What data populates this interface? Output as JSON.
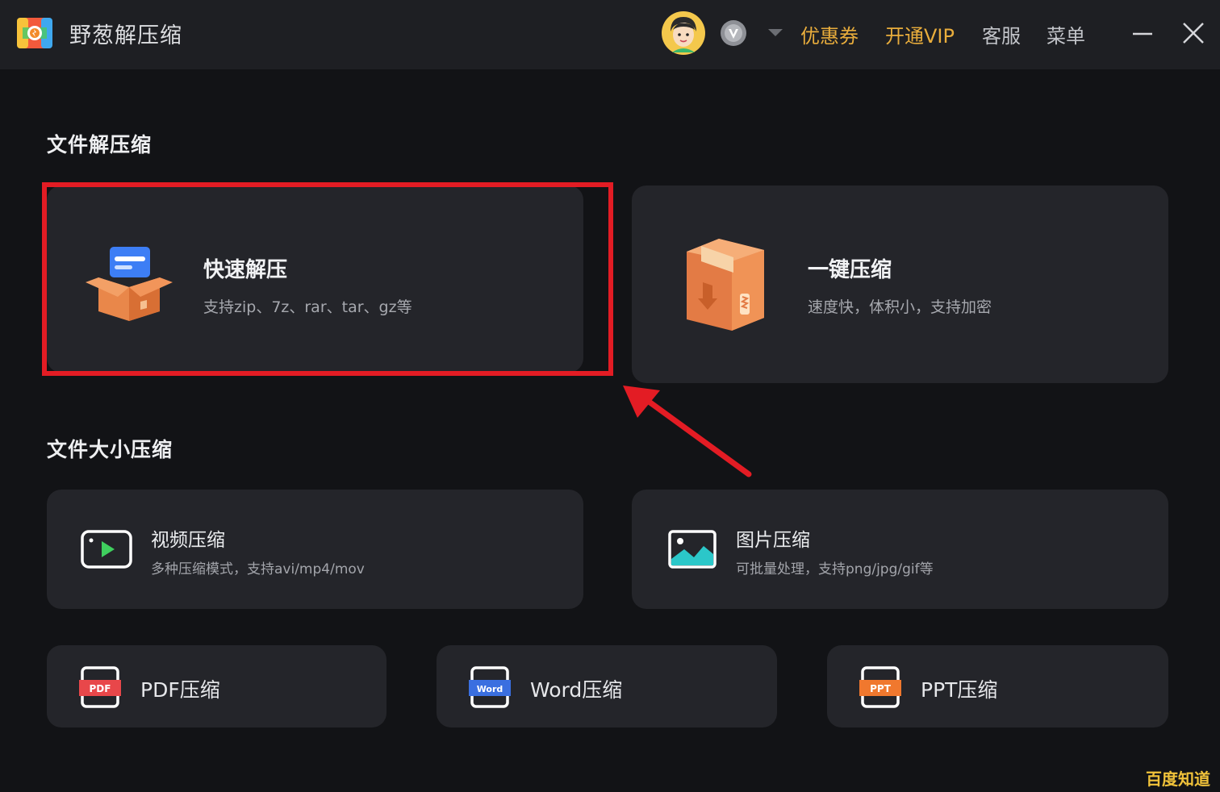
{
  "header": {
    "app_title": "野葱解压缩",
    "coupon": "优惠券",
    "vip": "开通VIP",
    "service": "客服",
    "menu": "菜单"
  },
  "sections": {
    "extract_title": "文件解压缩",
    "size_title": "文件大小压缩"
  },
  "cards": {
    "quick_extract": {
      "title": "快速解压",
      "desc": "支持zip、7z、rar、tar、gz等"
    },
    "one_click": {
      "title": "一键压缩",
      "desc": "速度快，体积小，支持加密"
    },
    "video": {
      "title": "视频压缩",
      "desc": "多种压缩模式，支持avi/mp4/mov"
    },
    "image": {
      "title": "图片压缩",
      "desc": "可批量处理，支持png/jpg/gif等"
    },
    "pdf": {
      "label": "PDF压缩",
      "icon_text": "PDF"
    },
    "word": {
      "label": "Word压缩",
      "icon_text": "Word"
    },
    "ppt": {
      "label": "PPT压缩",
      "icon_text": "PPT"
    }
  },
  "watermark": "百度知道",
  "colors": {
    "accent_gold": "#e9ad3c",
    "highlight": "#e31c24",
    "pdf": "#e8474a",
    "word": "#3a6fe0",
    "ppt": "#f0782e"
  },
  "icons": {
    "logo": "archive-logo-icon",
    "avatar": "user-avatar-icon",
    "vip": "vip-badge-icon",
    "box_open": "open-box-icon",
    "box_closed": "closed-box-icon",
    "video": "video-icon",
    "image": "image-icon"
  }
}
